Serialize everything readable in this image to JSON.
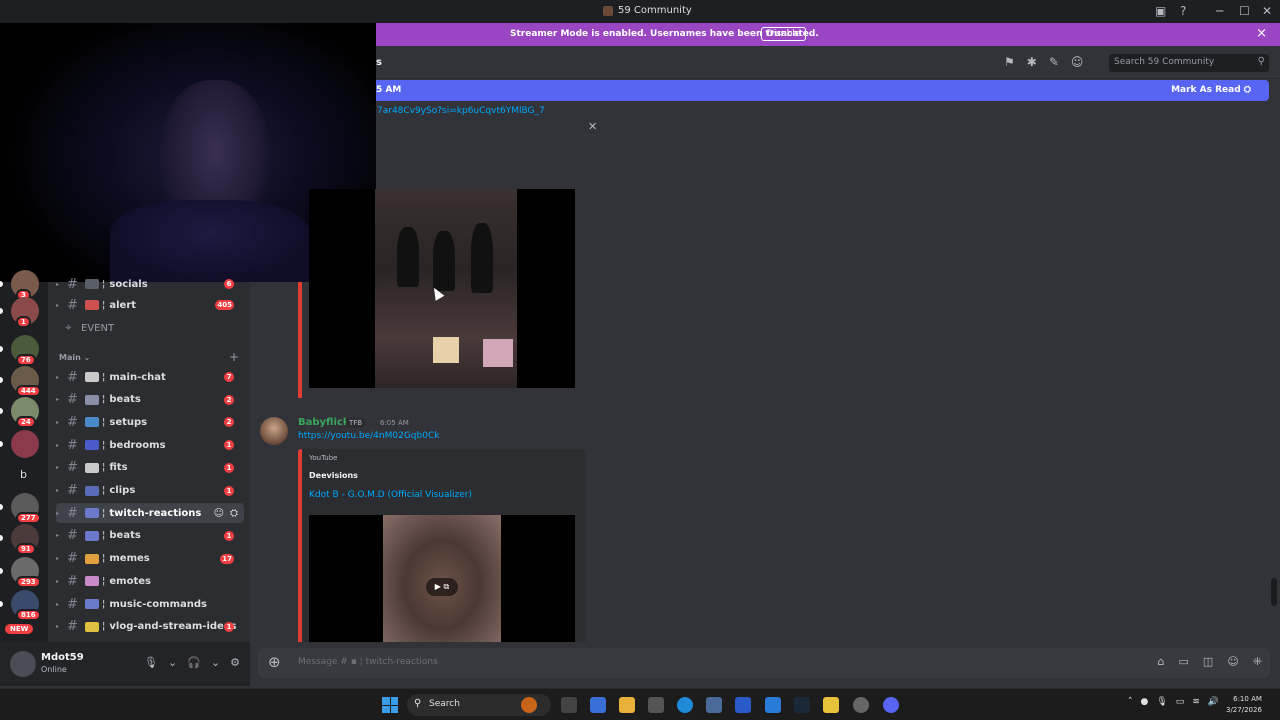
{
  "window": {
    "title": "59 Community"
  },
  "banner": {
    "message": "Streamer Mode is enabled. Usernames have been truncated.",
    "disable_label": "Disable",
    "close_icon": "×"
  },
  "header": {
    "channel_fragment": "s",
    "search_placeholder": "Search 59 Community"
  },
  "new_messages": {
    "time_fragment": "5 AM",
    "mark_read_label": "Mark As Read"
  },
  "messages": {
    "first_link_fragment": "7ar48Cv9ySo?si=kp6uCqvt6YMlBG_7",
    "second": {
      "author": "Babyflick",
      "tag": "TFB",
      "time": "6:05 AM",
      "link": "https://youtu.be/4nM02Gqb0Ck",
      "embed_provider": "YouTube",
      "embed_author": "Deevisions",
      "embed_title": "Kdot B - G.O.M.D (Official Visualizer)"
    }
  },
  "servers": [
    {
      "badge": "3",
      "color": "#7a5a4a"
    },
    {
      "badge": "1",
      "color": "#8a4a4a"
    },
    {
      "badge": "76",
      "color": "#4a5a3a"
    },
    {
      "badge": "444",
      "color": "#6a5a4a"
    },
    {
      "badge": "24",
      "color": "#7a8a6a"
    },
    {
      "badge": "",
      "color": "#8a3a4a"
    },
    {
      "badge": "",
      "color": "#2b2d31"
    },
    {
      "badge": "277",
      "color": "#5a5a5a"
    },
    {
      "badge": "91",
      "color": "#4a3a3a"
    },
    {
      "badge": "293",
      "color": "#6a6a6a"
    },
    {
      "badge": "816",
      "color": "#3a4a6a"
    }
  ],
  "server_letter": "b",
  "new_badge": "NEW",
  "channels": {
    "top_partial": {
      "name": "socials",
      "badge": "6"
    },
    "alert": {
      "name": "alert",
      "badge": "405"
    },
    "event_label": "EVENT",
    "category_main": "Main",
    "list": [
      {
        "name": "main-chat",
        "badge": "7",
        "emoji_color": "#c9c9c9"
      },
      {
        "name": "beats",
        "badge": "2",
        "emoji_color": "#8a8fa8"
      },
      {
        "name": "setups",
        "badge": "2",
        "emoji_color": "#4a8ac9"
      },
      {
        "name": "bedrooms",
        "badge": "1",
        "emoji_color": "#4a5ac9"
      },
      {
        "name": "fits",
        "badge": "1",
        "emoji_color": "#c9c9c9"
      },
      {
        "name": "clips",
        "badge": "1",
        "emoji_color": "#5a6ab9"
      },
      {
        "name": "twitch-reactions",
        "badge": "",
        "emoji_color": "#6a7ac9"
      },
      {
        "name": "beats",
        "badge": "1",
        "emoji_color": "#6a7ac9"
      },
      {
        "name": "memes",
        "badge": "17",
        "emoji_color": "#e0a040"
      },
      {
        "name": "emotes",
        "badge": "",
        "emoji_color": "#c98ac9"
      },
      {
        "name": "music-commands",
        "badge": "",
        "emoji_color": "#6a7ac9"
      },
      {
        "name": "vlog-and-stream-ideas",
        "badge": "1",
        "emoji_color": "#e0c040"
      }
    ]
  },
  "user": {
    "name": "Mdot59",
    "status": "Online"
  },
  "composer": {
    "placeholder": "Message #",
    "channel": "twitch-reactions"
  },
  "taskbar": {
    "search_label": "Search",
    "time": "6:10 AM",
    "date": "3/27/2026"
  },
  "colors": {
    "accent": "#5865f2",
    "streamer_banner": "#9a46c3",
    "alert_red": "#f23f43",
    "link": "#00a8fc"
  }
}
